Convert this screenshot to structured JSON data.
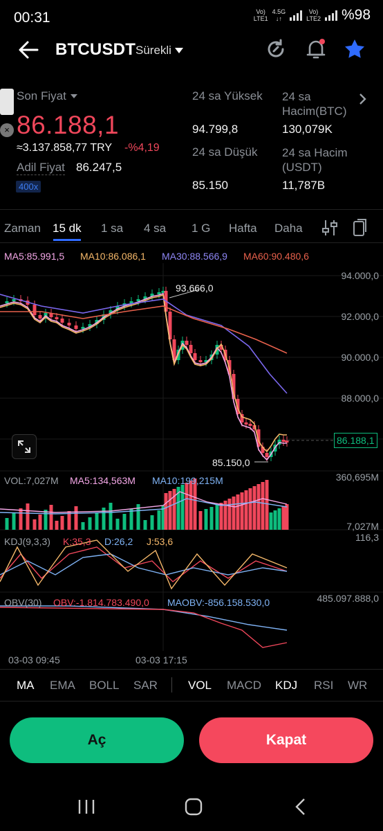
{
  "status_bar": {
    "time": "00:31",
    "sim1_label": "Vo)",
    "sim1_sub": "LTE1",
    "net_type": "4.5G",
    "sim2_label": "Vo)",
    "sim2_sub": "LTE2",
    "battery": "%98"
  },
  "header": {
    "pair": "BTCUSDT",
    "contract_type": "Sürekli"
  },
  "ticker": {
    "last_price_label": "Son Fiyat",
    "last_price": "86.188,1",
    "try_value": "≈3.137.858,77 TRY",
    "change": "-%4,19",
    "fair_price_label": "Adil Fiyat",
    "fair_price": "86.247,5",
    "leverage": "400x",
    "high_label": "24 sa Yüksek",
    "high": "94.799,8",
    "vol_btc_label_1": "24 sa",
    "vol_btc_label_2": "Hacim(BTC)",
    "vol_btc": "130,079K",
    "low_label": "24 sa Düşük",
    "low": "85.150",
    "vol_usdt_label_1": "24 sa Hacim",
    "vol_usdt_label_2": "(USDT)",
    "vol_usdt": "11,787B"
  },
  "interval_tabs": [
    "Zaman",
    "15 dk",
    "1 sa",
    "4 sa",
    "1 G",
    "Hafta",
    "Daha"
  ],
  "active_interval": "15 dk",
  "chart_legend": {
    "ma5": "MA5:85.991,5",
    "ma10": "MA10:86.086,1",
    "ma30": "MA30:88.566,9",
    "ma60": "MA60:90.480,6"
  },
  "chart_labels": {
    "y_ticks": [
      "94.000,0",
      "92.000,0",
      "90.000,0",
      "88.000,0"
    ],
    "current_price_tag": "86.188,1",
    "high_marker": "93.666,0",
    "low_marker": "85.150,0",
    "vol_legend": "VOL:7,027M",
    "vol_ma5": "MA5:134,563M",
    "vol_ma10": "MA10:199,215M",
    "vol_max": "360,695M",
    "vol_min": "7,027M",
    "kdj_legend": "KDJ(9,3,3)",
    "kdj_k": "K:35,3",
    "kdj_d": "D:26,2",
    "kdj_j": "J:53,6",
    "kdj_max": "116,3",
    "obv_legend": "OBV(30)",
    "obv_value": "OBV:-1.814.783.490,0",
    "maobv_value": "MAOBV:-856.158.530,0",
    "obv_max": "485.097.888,0",
    "time_1": "03-03 09:45",
    "time_2": "03-03 17:15"
  },
  "indicator_tabs": {
    "main": [
      "MA",
      "EMA",
      "BOLL",
      "SAR"
    ],
    "sub": [
      "VOL",
      "MACD",
      "KDJ",
      "RSI",
      "WR"
    ]
  },
  "buttons": {
    "open": "Aç",
    "close": "Kapat"
  },
  "colors": {
    "up": "#0ebd7e",
    "down": "#f0475b",
    "accent": "#2f6bff",
    "ma5": "#f4a7e7",
    "ma10": "#f5b86a",
    "ma30": "#7b68ee",
    "ma60": "#e8614c"
  }
}
